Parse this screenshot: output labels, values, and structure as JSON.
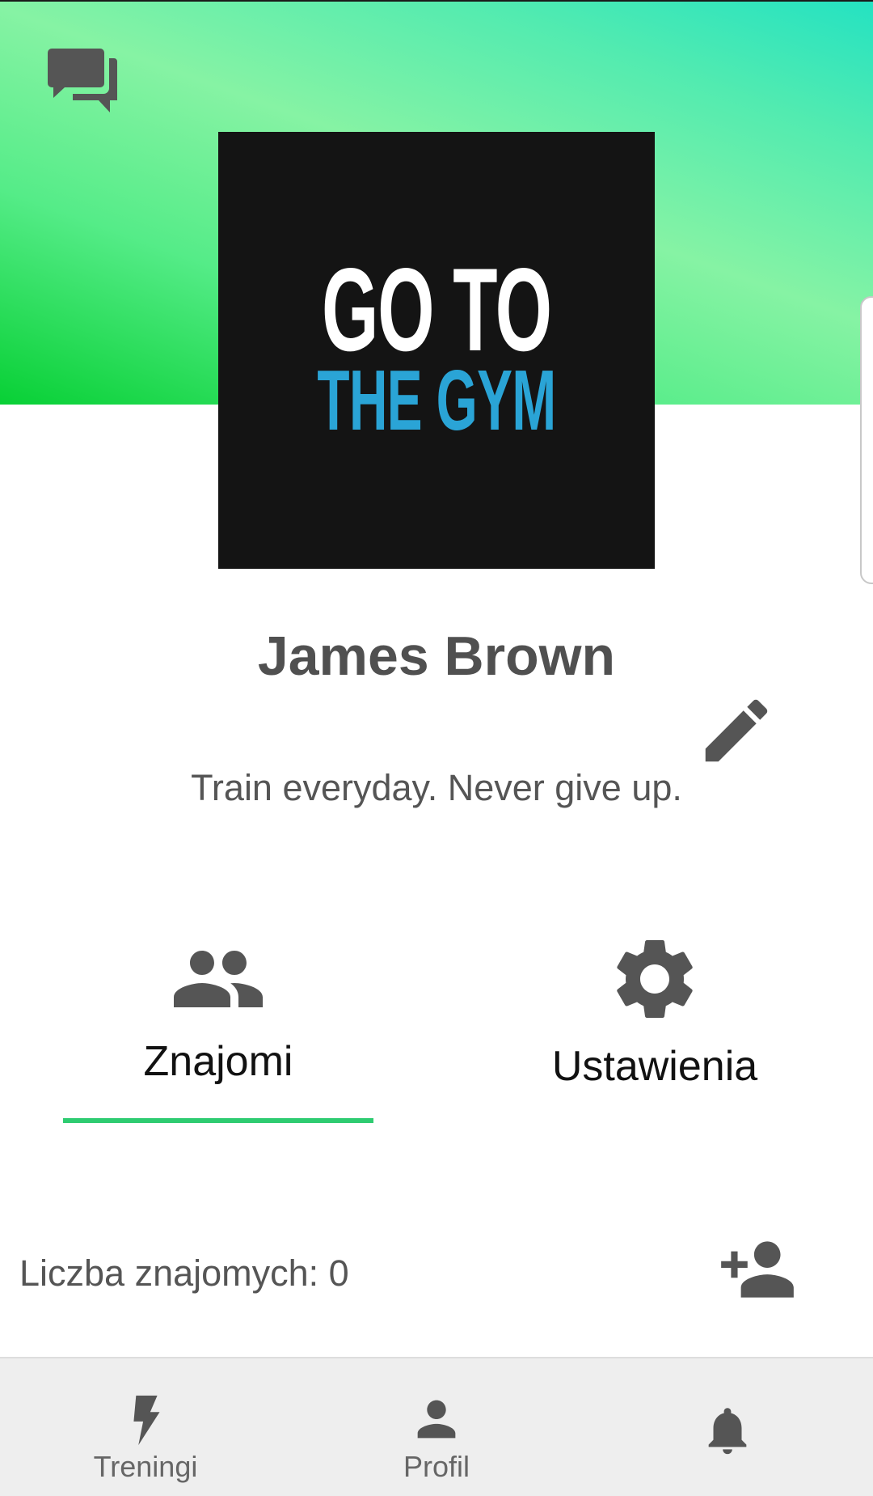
{
  "header": {
    "chat_icon": "forum-icon",
    "gradient_colors": [
      "#08d035",
      "#86f3a4",
      "#24e2c2"
    ]
  },
  "profile": {
    "avatar_logo": {
      "line1": "GO TO",
      "line2": "THE GYM",
      "line1_color": "#ffffff",
      "line2_color": "#2aa4d6",
      "background": "#141414"
    },
    "name": "James Brown",
    "bio": "Train everyday. Never give up.",
    "edit_icon": "pencil-icon"
  },
  "tabs": [
    {
      "label": "Znajomi",
      "icon": "people-icon",
      "active": true
    },
    {
      "label": "Ustawienia",
      "icon": "gear-icon",
      "active": false
    }
  ],
  "friends": {
    "count_text": "Liczba znajomych: 0",
    "add_icon": "person-add-icon"
  },
  "bottom_nav": {
    "items": [
      {
        "label": "Treningi",
        "icon": "bolt-icon"
      },
      {
        "label": "Profil",
        "icon": "person-icon"
      },
      {
        "label": "",
        "icon": "bell-icon"
      }
    ]
  },
  "colors": {
    "accent": "#2ecc71",
    "icon_gray": "#555555",
    "nav_bg": "#eeeeee"
  }
}
